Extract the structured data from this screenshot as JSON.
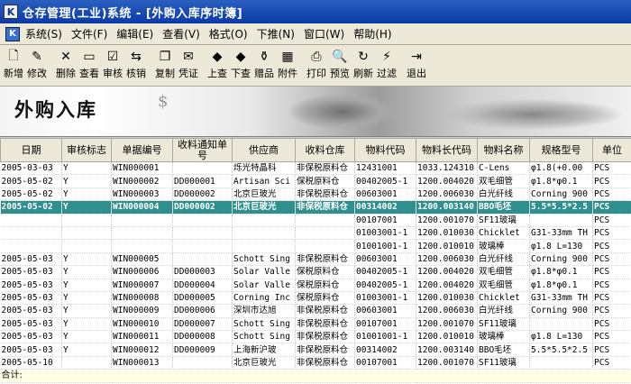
{
  "window": {
    "title": "仓存管理(工业)系统 - [外购入库序时簿]",
    "icon_label": "K"
  },
  "menu": {
    "icon_label": "K",
    "items": [
      "系统(S)",
      "文件(F)",
      "编辑(E)",
      "查看(V)",
      "格式(O)",
      "下推(N)",
      "窗口(W)",
      "帮助(H)"
    ]
  },
  "toolbar": {
    "buttons": [
      {
        "label": "新增",
        "icon": "new-doc-icon",
        "glyph": "🗋"
      },
      {
        "label": "修改",
        "icon": "edit-icon",
        "glyph": "✎"
      },
      {
        "label": "删除",
        "icon": "delete-icon",
        "glyph": "✕"
      },
      {
        "label": "查看",
        "icon": "view-icon",
        "glyph": "▭"
      },
      {
        "label": "审核",
        "icon": "audit-icon",
        "glyph": "☑"
      },
      {
        "label": "核销",
        "icon": "writeoff-icon",
        "glyph": "⇆"
      },
      {
        "label": "复制",
        "icon": "copy-icon",
        "glyph": "❐"
      },
      {
        "label": "凭证",
        "icon": "voucher-icon",
        "glyph": "✉"
      },
      {
        "label": "上查",
        "icon": "up-query-icon",
        "glyph": "◆"
      },
      {
        "label": "下查",
        "icon": "down-query-icon",
        "glyph": "◆"
      },
      {
        "label": "赠品",
        "icon": "gift-icon",
        "glyph": "⚱"
      },
      {
        "label": "附件",
        "icon": "attachment-icon",
        "glyph": "▦"
      },
      {
        "label": "打印",
        "icon": "print-icon",
        "glyph": "⎙"
      },
      {
        "label": "预览",
        "icon": "preview-icon",
        "glyph": "🔍"
      },
      {
        "label": "刷新",
        "icon": "refresh-icon",
        "glyph": "↻"
      },
      {
        "label": "过滤",
        "icon": "filter-icon",
        "glyph": "⚡"
      },
      {
        "label": "退出",
        "icon": "exit-icon",
        "glyph": "⇥"
      }
    ]
  },
  "banner": {
    "title": "外购入库",
    "symbol": "$"
  },
  "grid": {
    "columns": [
      "日期",
      "审核标志",
      "单据编号",
      "收料通知单号",
      "供应商",
      "收料仓库",
      "物料代码",
      "物料长代码",
      "物料名称",
      "规格型号",
      "单位"
    ],
    "rows": [
      [
        "2005-03-03",
        "Y",
        "WIN000001",
        "",
        "烁光特晶科",
        "非保税原料仓",
        "12431001",
        "1033.124310",
        "C-Lens",
        "φ1.8(+0.00",
        "PCS"
      ],
      [
        "2005-05-02",
        "Y",
        "WIN000002",
        "DD000001",
        "Artisan Sci",
        "保税原料仓",
        "00402005-1",
        "1200.004020",
        "双毛细管",
        "φ1.8*φ0.1",
        "PCS"
      ],
      [
        "2005-05-02",
        "Y",
        "WIN000003",
        "DD000002",
        "北京巨玻光",
        "非保税原料仓",
        "00603001",
        "1200.006030",
        "白光纤线",
        "Corning 900",
        "PCS"
      ],
      [
        "2005-05-02",
        "Y",
        "WIN000004",
        "DD000002",
        "北京巨玻光",
        "非保税原料仓",
        "00314002",
        "1200.003140",
        "BBO毛坯",
        "5.5*5.5*2.5",
        "PCS"
      ],
      [
        "",
        "",
        "",
        "",
        "",
        "",
        "00107001",
        "1200.001070",
        "SF11玻璃",
        "",
        "PCS"
      ],
      [
        "",
        "",
        "",
        "",
        "",
        "",
        "01003001-1",
        "1200.010030",
        "Chicklet",
        "G31-33mm TH",
        "PCS"
      ],
      [
        "",
        "",
        "",
        "",
        "",
        "",
        "01001001-1",
        "1200.010010",
        "玻璃棒",
        "φ1.8 L=130",
        "PCS"
      ],
      [
        "2005-05-03",
        "Y",
        "WIN000005",
        "",
        "Schott Sing",
        "非保税原料仓",
        "00603001",
        "1200.006030",
        "白光纤线",
        "Corning 900",
        "PCS"
      ],
      [
        "2005-05-03",
        "Y",
        "WIN000006",
        "DD000003",
        "Solar Valle",
        "保税原料仓",
        "00402005-1",
        "1200.004020",
        "双毛细管",
        "φ1.8*φ0.1",
        "PCS"
      ],
      [
        "2005-05-03",
        "Y",
        "WIN000007",
        "DD000004",
        "Solar Valle",
        "保税原料仓",
        "00402005-1",
        "1200.004020",
        "双毛细管",
        "φ1.8*φ0.1",
        "PCS"
      ],
      [
        "2005-05-03",
        "Y",
        "WIN000008",
        "DD000005",
        "Corning Inc",
        "保税原料仓",
        "01003001-1",
        "1200.010030",
        "Chicklet",
        "G31-33mm TH",
        "PCS"
      ],
      [
        "2005-05-03",
        "Y",
        "WIN000009",
        "DD000006",
        "深圳市达旭",
        "非保税原料仓",
        "00603001",
        "1200.006030",
        "白光纤线",
        "Corning 900",
        "PCS"
      ],
      [
        "2005-05-03",
        "Y",
        "WIN000010",
        "DD000007",
        "Schott Sing",
        "非保税原料仓",
        "00107001",
        "1200.001070",
        "SF11玻璃",
        "",
        "PCS"
      ],
      [
        "2005-05-03",
        "Y",
        "WIN000011",
        "DD000008",
        "Schott Sing",
        "非保税原料仓",
        "01001001-1",
        "1200.010010",
        "玻璃棒",
        "φ1.8 L=130",
        "PCS"
      ],
      [
        "2005-05-03",
        "Y",
        "WIN000012",
        "DD000009",
        "上海新沪玻",
        "非保税原料仓",
        "00314002",
        "1200.003140",
        "BBO毛坯",
        "5.5*5.5*2.5",
        "PCS"
      ],
      [
        "2005-05-10",
        "",
        "WIN000013",
        "",
        "北京巨玻光",
        "非保税原料仓",
        "00107001",
        "1200.001070",
        "SF11玻璃",
        "",
        "PCS"
      ]
    ],
    "selected_row_index": 3,
    "footer_label": "合计:"
  },
  "colors": {
    "selected_row": "#2e8f8f",
    "title_bar": "#0a3aa8"
  }
}
